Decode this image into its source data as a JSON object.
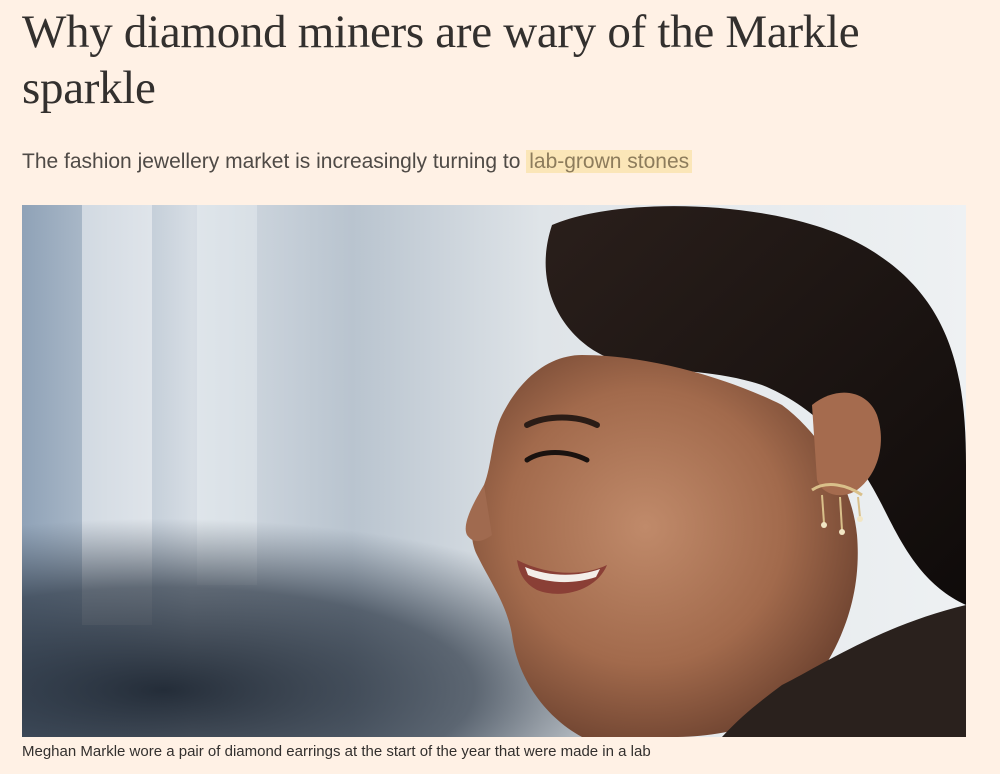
{
  "article": {
    "headline": "Why diamond miners are wary of the Markle sparkle",
    "standfirst_text": "The fashion jewellery market is increasingly turning to ",
    "standfirst_link": "lab-grown stones",
    "image_caption": "Meghan Markle wore a pair of diamond earrings at the start of the year that were made in a lab"
  },
  "colors": {
    "page_background": "#fff1e5",
    "headline_text": "#33302e",
    "link_highlight": "#fbe6b8"
  }
}
